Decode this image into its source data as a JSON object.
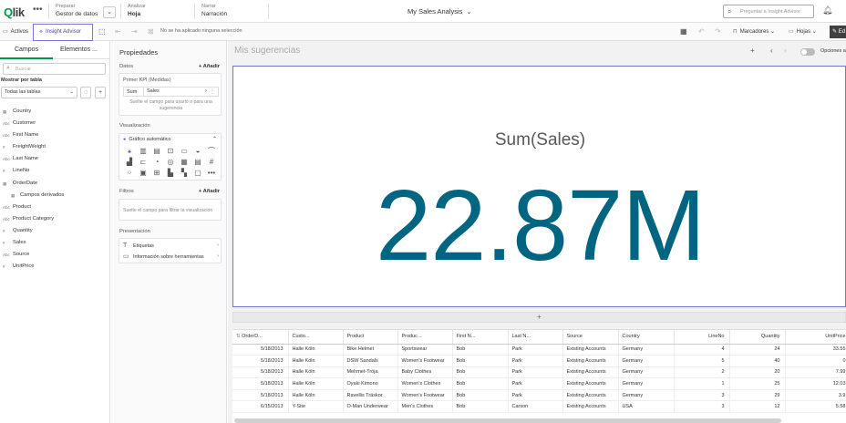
{
  "header": {
    "logo": "Qlik",
    "nav": [
      {
        "small": "Preparar",
        "big": "Gestor de datos"
      },
      {
        "small": "Analizar",
        "big": "Hoja"
      },
      {
        "small": "Narrar",
        "big": "Narración"
      }
    ],
    "app_title": "My Sales Analysis",
    "search_placeholder": "Preguntar a Insight Advisor"
  },
  "toolbar": {
    "assets": "Activos",
    "insight_advisor": "Insight Advisor",
    "no_selection": "No se ha aplicado ninguna selección",
    "bookmarks": "Marcadores",
    "sheets": "Hojas",
    "edit": "Ed"
  },
  "left_panel": {
    "tabs": [
      "Campos",
      "Elementos ..."
    ],
    "search_placeholder": "Buscar",
    "show_by": "Mostrar por tabla",
    "table_select": "Todas las tablas",
    "fields": [
      {
        "type": "cal",
        "name": "Country",
        "sub": false
      },
      {
        "type": "Abc",
        "name": "Customer",
        "sub": false
      },
      {
        "type": "Abc",
        "name": "First Name",
        "sub": false
      },
      {
        "type": "#",
        "name": "FreightWeight",
        "sub": false
      },
      {
        "type": "Abc",
        "name": "Last Name",
        "sub": false
      },
      {
        "type": "#",
        "name": "LineNo",
        "sub": false
      },
      {
        "type": "cal",
        "name": "OrderDate",
        "sub": false
      },
      {
        "type": "cal",
        "name": "Campos derivados",
        "sub": true
      },
      {
        "type": "Abc",
        "name": "Product",
        "sub": false
      },
      {
        "type": "Abc",
        "name": "Product Category",
        "sub": false
      },
      {
        "type": "#",
        "name": "Quantity",
        "sub": false
      },
      {
        "type": "#",
        "name": "Sales",
        "sub": false
      },
      {
        "type": "Abc",
        "name": "Source",
        "sub": false
      },
      {
        "type": "#",
        "name": "UnitPrice",
        "sub": false
      }
    ]
  },
  "properties": {
    "title": "Propiedades",
    "data_label": "Datos",
    "add": "+ Añadir",
    "kpi_title": "Primer KPI (Medidas)",
    "kpi_agg": "Sum",
    "kpi_field": "Sales",
    "kpi_hint": "Suelte el campo para usarlo o para una sugerencia",
    "viz_label": "Visualización",
    "viz_auto": "Gráfico automático",
    "filters_label": "Filtros",
    "filters_hint": "Suelte el campo para filtrar la visualización",
    "presentation_label": "Presentación",
    "pres_items": [
      "Etiquetas",
      "Información sobre herramientas"
    ]
  },
  "main": {
    "suggestions_title": "Mis sugerencias",
    "options_label": "Opciones a",
    "kpi_label": "Sum(Sales)",
    "kpi_value": "22.87M"
  },
  "table": {
    "headers": [
      "OrderD...",
      "Custo...",
      "Product",
      "Produc...",
      "First N...",
      "Last N...",
      "Source",
      "Country",
      "LineNo",
      "Quantity",
      "UnitPrice"
    ],
    "rows": [
      [
        "5/18/2013",
        "Halle Köln",
        "Bike Helmet",
        "Sportswear",
        "Bob",
        "Park",
        "Existing Accounts",
        "Germany",
        "4",
        "24",
        "33.55"
      ],
      [
        "5/18/2013",
        "Halle Köln",
        "DSW Sandals",
        "Women's Footwear",
        "Bob",
        "Park",
        "Existing Accounts",
        "Germany",
        "5",
        "40",
        "0"
      ],
      [
        "5/18/2013",
        "Halle Köln",
        "Mehmet-Trója",
        "Baby Clothes",
        "Bob",
        "Park",
        "Existing Accounts",
        "Germany",
        "2",
        "20",
        "7.99"
      ],
      [
        "5/18/2013",
        "Halle Köln",
        "Oyaki Kimono",
        "Women's Clothes",
        "Bob",
        "Park",
        "Existing Accounts",
        "Germany",
        "1",
        "25",
        "12.03"
      ],
      [
        "5/18/2013",
        "Halle Köln",
        "Ravellis Träskor",
        "Women's Footwear",
        "Bob",
        "Park",
        "Existing Accounts",
        "Germany",
        "3",
        "29",
        "3.9"
      ],
      [
        "6/15/2013",
        "Y-Site",
        "O-Man Underwear",
        "Men's Clothes",
        "Bob",
        "Carson",
        "Existing Accounts",
        "USA",
        "3",
        "12",
        "5.58"
      ]
    ]
  }
}
